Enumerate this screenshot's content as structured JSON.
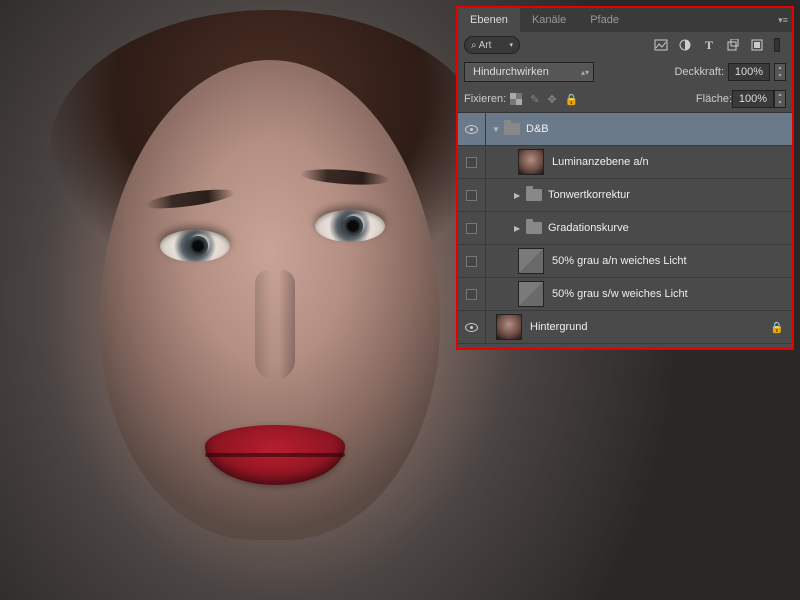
{
  "tabs": {
    "layers": "Ebenen",
    "channels": "Kanäle",
    "paths": "Pfade"
  },
  "filter": {
    "search_label": "Art"
  },
  "blend": {
    "mode": "Hindurchwirken",
    "opacity_label": "Deckkraft:",
    "opacity_value": "100%",
    "lock_label": "Fixieren:",
    "fill_label": "Fläche:",
    "fill_value": "100%"
  },
  "layers": [
    {
      "name": "D&B",
      "type": "group",
      "visible": true,
      "expanded": true,
      "selected": true
    },
    {
      "name": "Luminanzebene a/n",
      "type": "image",
      "visible": false,
      "thumb": "face"
    },
    {
      "name": "Tonwertkorrektur",
      "type": "group",
      "visible": false,
      "expanded": false
    },
    {
      "name": "Gradationskurve",
      "type": "group",
      "visible": false,
      "expanded": false
    },
    {
      "name": "50% grau a/n weiches Licht",
      "type": "image",
      "visible": false,
      "thumb": "gray"
    },
    {
      "name": "50% grau s/w weiches Licht",
      "type": "image",
      "visible": false,
      "thumb": "gray"
    },
    {
      "name": "Hintergrund",
      "type": "image",
      "visible": true,
      "thumb": "face",
      "locked": true
    }
  ]
}
